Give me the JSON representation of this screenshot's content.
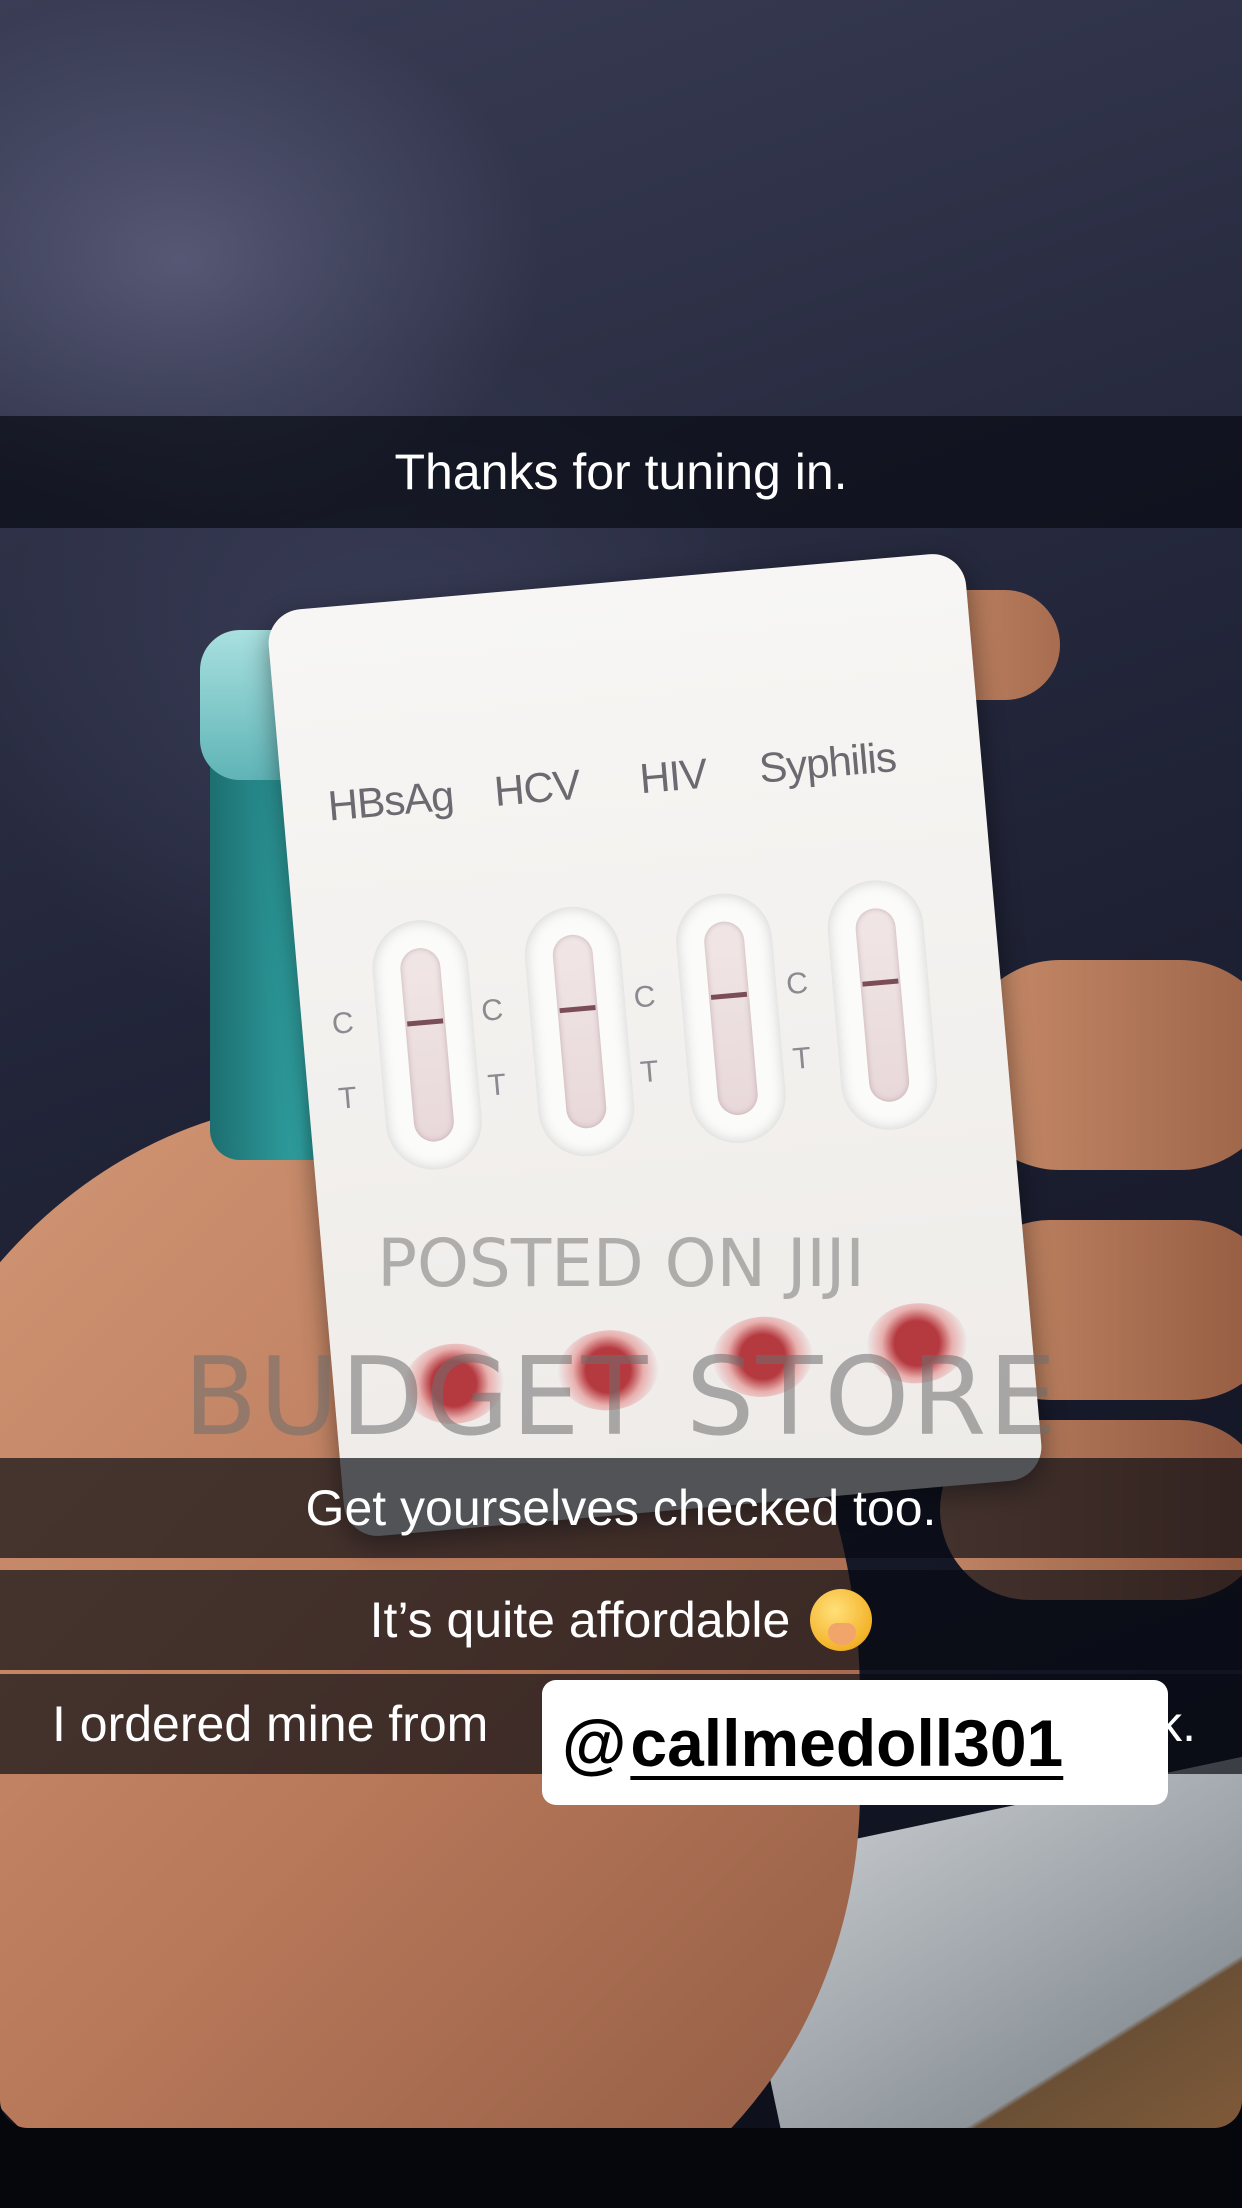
{
  "captions": {
    "top": "Thanks for tuning in.",
    "line1": "Get yourselves checked too.",
    "line2": "It’s quite affordable",
    "line3": "I ordered mine from",
    "line3_tail": "k."
  },
  "emoji": "hand-over-mouth-emoji",
  "mention": {
    "at": "@",
    "handle": "callmedoll301"
  },
  "test_card": {
    "labels": [
      "HBsAg",
      "HCV",
      "HIV",
      "Syphilis"
    ],
    "control_letter": "C",
    "test_letter": "T"
  },
  "watermark": {
    "line1": "POSTED ON JIJI",
    "line2": "BUDGET STORE"
  }
}
